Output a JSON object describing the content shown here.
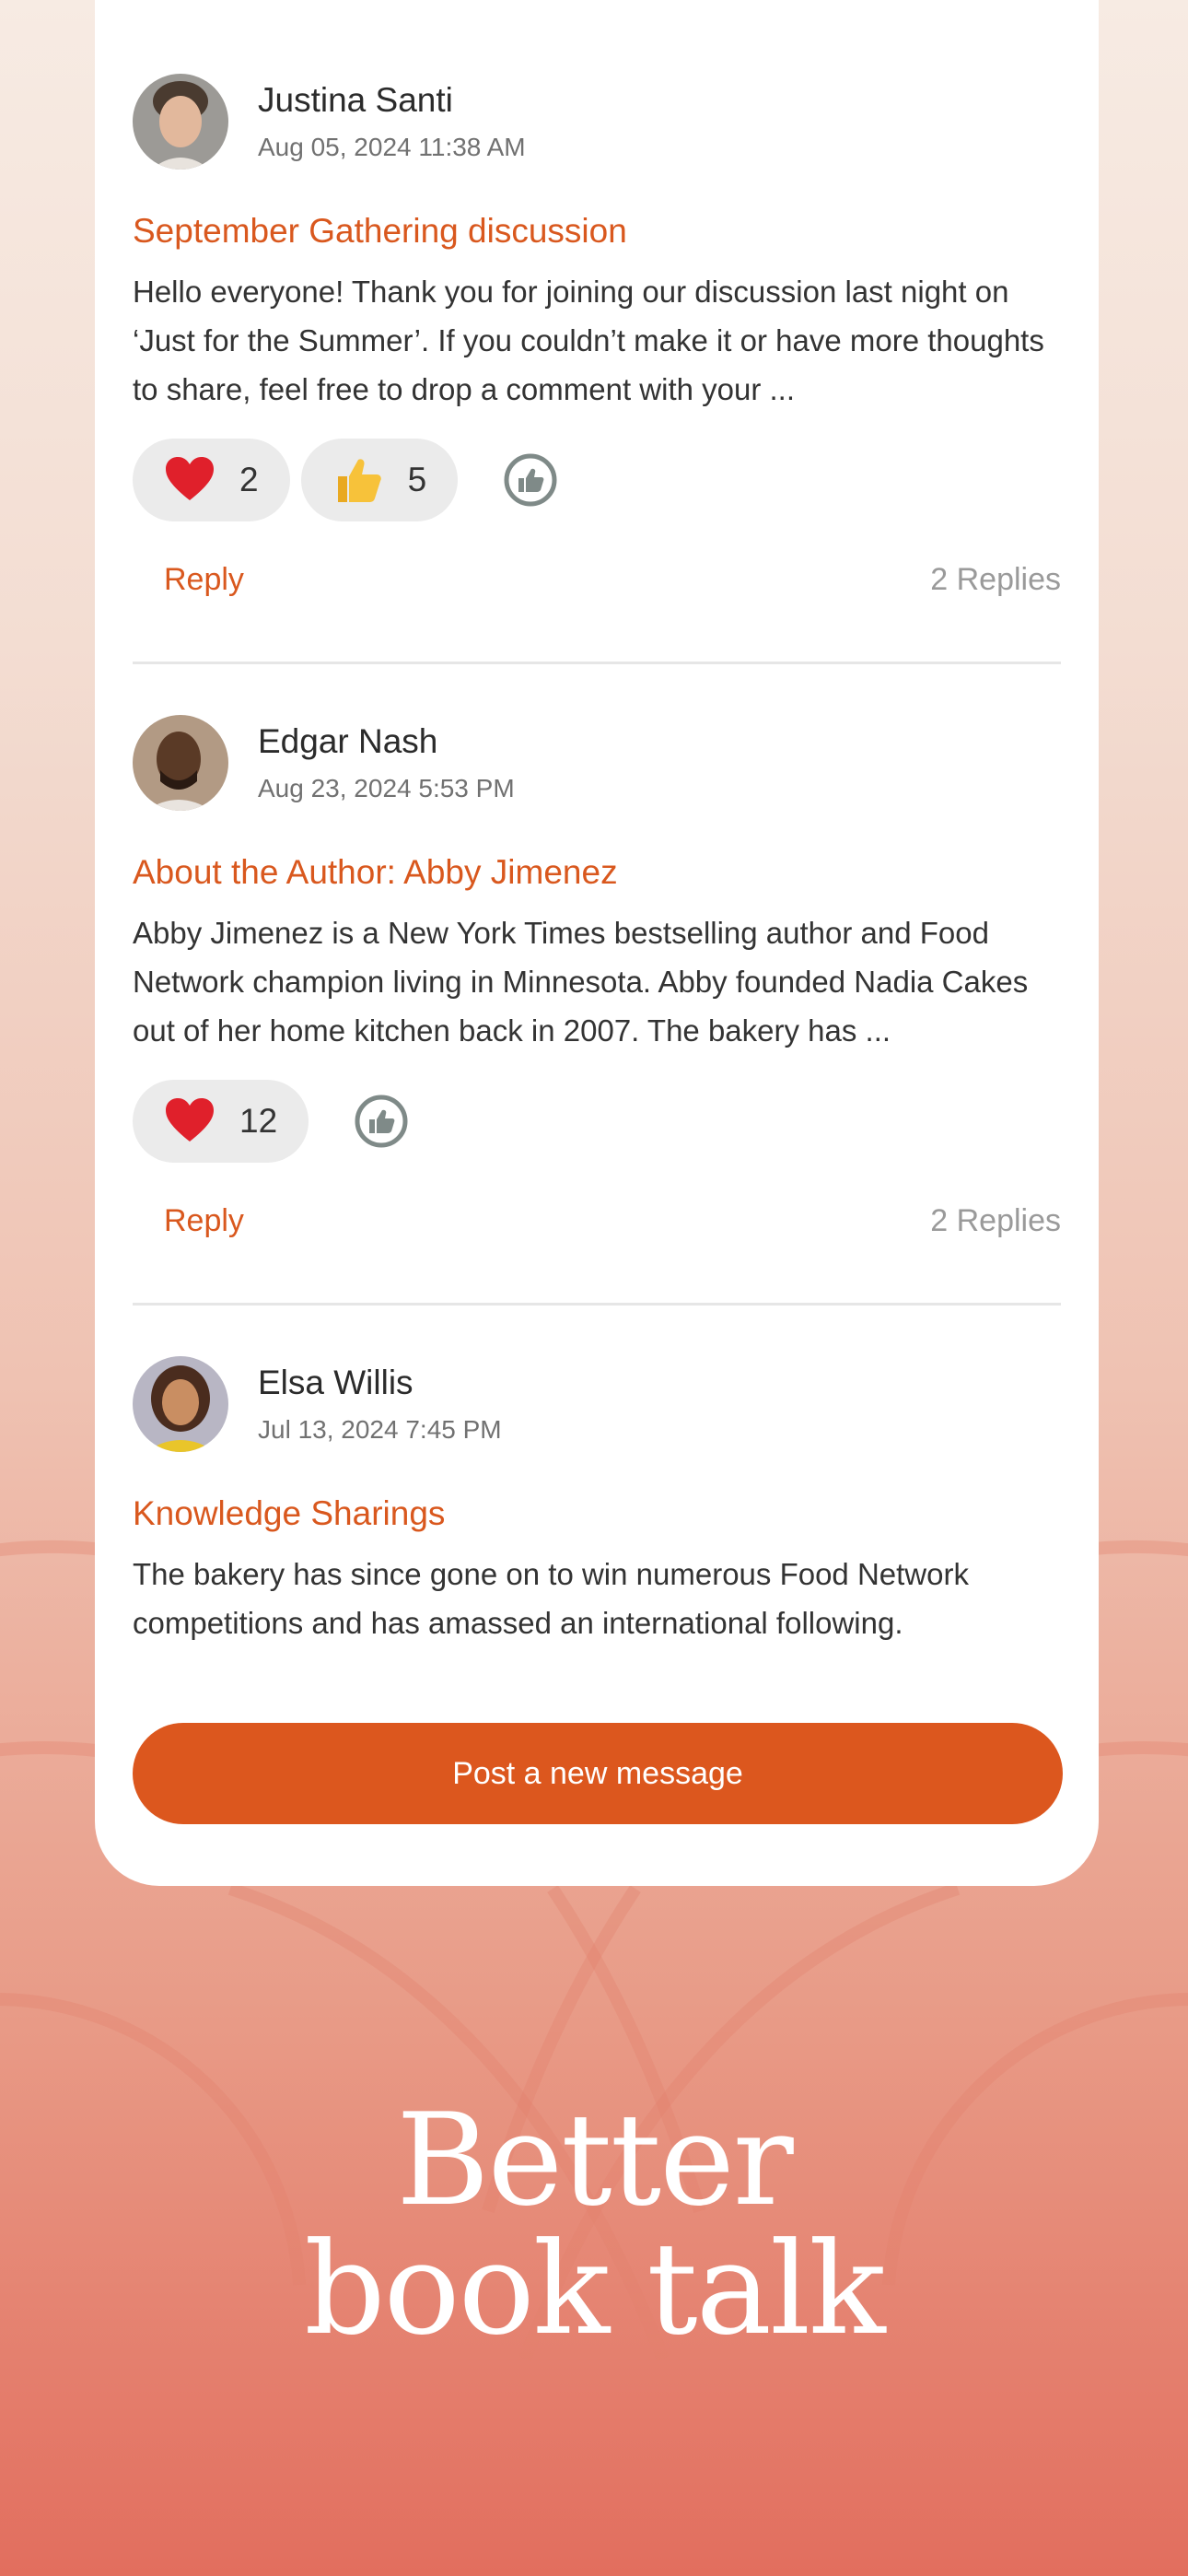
{
  "posts": [
    {
      "author": "Justina Santi",
      "date": "Aug 05, 2024 11:38 AM",
      "title": "September Gathering discussion",
      "body": "Hello everyone! Thank you for joining our discussion last night on ‘Just for the Summer’. If you couldn’t make it or have more thoughts to share, feel free to drop a comment with your ...",
      "reactions": [
        {
          "emoji": "heart-icon",
          "count": "2"
        },
        {
          "emoji": "thumbs-up-icon",
          "count": "5"
        }
      ],
      "reply_label": "Reply",
      "replies_label": "2 Replies"
    },
    {
      "author": "Edgar Nash",
      "date": "Aug 23, 2024 5:53 PM",
      "title": "About the Author: Abby Jimenez",
      "body": "Abby Jimenez is a New York Times bestselling author and Food Network champion living in Minnesota. Abby founded Nadia Cakes out of her home kitchen back in 2007. The bakery has ...",
      "reactions": [
        {
          "emoji": "heart-icon",
          "count": "12"
        }
      ],
      "reply_label": "Reply",
      "replies_label": "2 Replies"
    },
    {
      "author": "Elsa Willis",
      "date": "Jul 13, 2024 7:45 PM",
      "title": "Knowledge Sharings",
      "body": "The bakery has since gone on to win numerous Food Network competitions and has amassed an international following."
    }
  ],
  "cta": {
    "label": "Post a new message"
  },
  "tagline": {
    "line1": "Better",
    "line2": "book talk"
  },
  "colors": {
    "accent": "#dc571e",
    "title": "#d9581e",
    "pill": "#ebebeb",
    "muted": "#9a9a9a"
  }
}
